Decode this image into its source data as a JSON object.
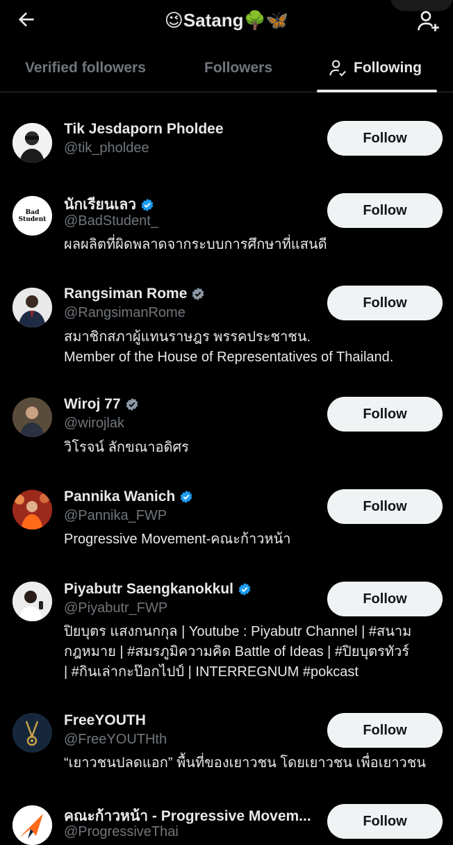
{
  "header": {
    "title": "😉Satang🌳🦋",
    "back_icon": "arrow-left-icon",
    "add_user_icon": "add-user-icon"
  },
  "tabs": [
    {
      "label": "Verified followers",
      "active": false
    },
    {
      "label": "Followers",
      "active": false
    },
    {
      "label": "Following",
      "active": true
    }
  ],
  "follow_label": "Follow",
  "accounts": [
    {
      "name": "Tik Jesdaporn Pholdee",
      "verified": false,
      "handle": "@tik_pholdee",
      "bio": ""
    },
    {
      "name": "นักเรียนเลว",
      "verified": true,
      "handle": "@BadStudent_",
      "bio": "ผลผลิตที่ผิดพลาดจากระบบการศึกษาที่แสนดี",
      "avatar_text": "Bad Student"
    },
    {
      "name": "Rangsiman Rome",
      "verified": true,
      "handle": "@RangsimanRome",
      "bio": "สมาชิกสภาผู้แทนราษฎร พรรคประชาชน.\nMember of the House of Representatives of Thailand."
    },
    {
      "name": "Wiroj 77",
      "verified": true,
      "handle": "@wirojlak",
      "bio": "วิโรจน์ ลักขณาอดิศร"
    },
    {
      "name": "Pannika Wanich",
      "verified": true,
      "handle": "@Pannika_FWP",
      "bio": "Progressive Movement-คณะก้าวหน้า"
    },
    {
      "name": "Piyabutr Saengkanokkul",
      "verified": true,
      "handle": "@Piyabutr_FWP",
      "bio": "ปิยบุตร แสงกนกกุล | Youtube : Piyabutr Channel | #สนาม\nกฎหมาย | #สมรภูมิความคิด Battle of Ideas | #ปิยบุตรทัวร์\n| #กินเล่ากะป๊อกไปป์ | INTERREGNUM #pokcast"
    },
    {
      "name": "FreeYOUTH",
      "verified": false,
      "handle": "@FreeYOUTHth",
      "bio": "“เยาวชนปลดแอก” พื้นที่ของเยาวชน โดยเยาวชน เพื่อเยาวชน"
    },
    {
      "name": "คณะก้าวหน้า - Progressive Movem...",
      "verified": false,
      "handle": "@ProgressiveThai",
      "bio": ""
    }
  ],
  "colors": {
    "background": "#000000",
    "text": "#e7e9ea",
    "muted": "#71767b",
    "verified": "#1d9bf0",
    "button_bg": "#eff3f4"
  }
}
